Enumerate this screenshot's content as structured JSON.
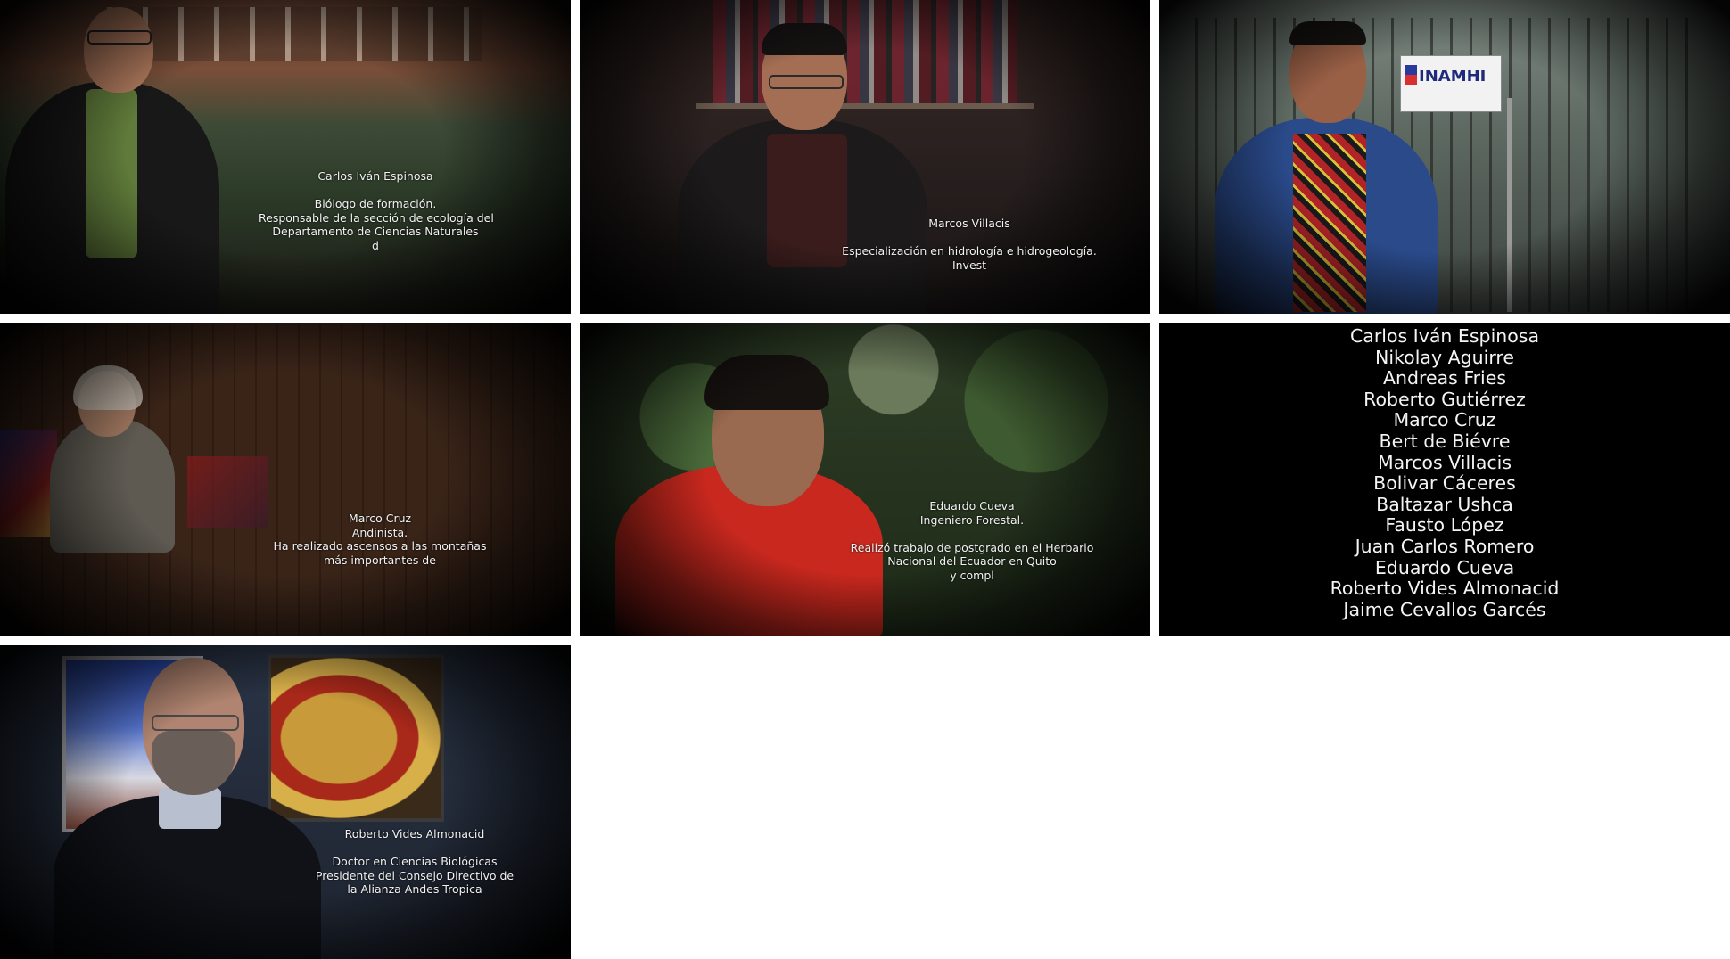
{
  "panels": [
    {
      "name": "Carlos Iván Espinosa",
      "lines": [
        "Biólogo de formación.",
        "Responsable de la sección de ecología del",
        "Departamento de Ciencias Naturales",
        "d"
      ]
    },
    {
      "name": "Marcos Villacis",
      "lines": [
        "Especialización  en hidrología e hidrogeología.",
        "Invest"
      ]
    },
    {
      "sign": "INAMHI"
    },
    {
      "name": "Marco Cruz",
      "lines": [
        "Andinista.",
        "Ha realizado ascensos  a las montañas",
        "más importantes de"
      ]
    },
    {
      "name": "Eduardo Cueva",
      "subtitle": "Ingeniero Forestal.",
      "lines": [
        "Realizó trabajo de postgrado en el Herbario",
        "Nacional del Ecuador en Quito",
        "y compl"
      ]
    },
    {
      "credits": [
        "Carlos Iván Espinosa",
        "Nikolay Aguirre",
        "Andreas Fries",
        "Roberto Gutiérrez",
        "Marco Cruz",
        "Bert de Biévre",
        "Marcos Villacis",
        "Bolivar Cáceres",
        "Baltazar Ushca",
        "Fausto López",
        "Juan Carlos Romero",
        "Eduardo Cueva",
        "Roberto Vides Almonacid",
        "Jaime Cevallos Garcés"
      ]
    },
    {
      "name": "Roberto Vides Almonacid",
      "lines": [
        "Doctor en Ciencias Biológicas",
        "Presidente del Consejo Directivo de",
        "la Alianza  Andes Tropica"
      ]
    }
  ]
}
